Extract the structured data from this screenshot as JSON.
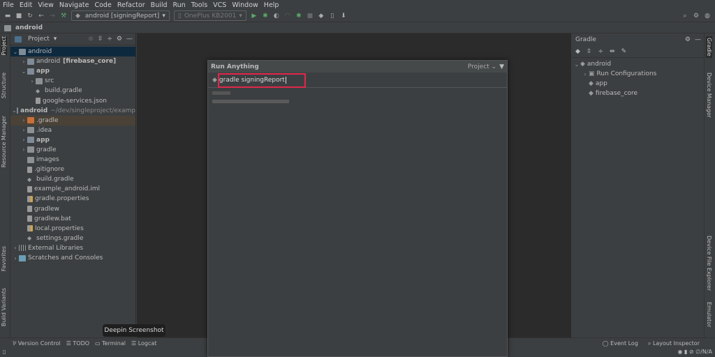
{
  "menu": [
    "File",
    "Edit",
    "View",
    "Navigate",
    "Code",
    "Refactor",
    "Build",
    "Run",
    "Tools",
    "VCS",
    "Window",
    "Help"
  ],
  "toolbar": {
    "run_config": "android [signingReport]",
    "device": "OnePlus KB2001"
  },
  "breadcrumb": "android",
  "left_stripe": [
    "Project",
    "Structure",
    "Resource Manager",
    "Favorites",
    "Build Variants"
  ],
  "project_panel": {
    "title": "Project",
    "tree": [
      {
        "label": "android",
        "depth": 0,
        "arrow": "v",
        "bold": false,
        "selected": true,
        "icon": "module"
      },
      {
        "label": "android",
        "suffix": "[firebase_core]",
        "depth": 1,
        "arrow": ">",
        "icon": "module"
      },
      {
        "label": "app",
        "depth": 1,
        "arrow": "v",
        "bold": true,
        "icon": "module"
      },
      {
        "label": "src",
        "depth": 2,
        "arrow": ">",
        "icon": "folder"
      },
      {
        "label": "build.gradle",
        "depth": 2,
        "arrow": "",
        "icon": "gradle"
      },
      {
        "label": "google-services.json",
        "depth": 2,
        "arrow": "",
        "icon": "file"
      },
      {
        "label": "android",
        "suffix": "~/dev/singleproject/examp",
        "depth": 0,
        "arrow": "v",
        "bold": true,
        "icon": "module"
      },
      {
        "label": ".gradle",
        "depth": 1,
        "arrow": ">",
        "icon": "folder-orange",
        "highlight": true
      },
      {
        "label": ".idea",
        "depth": 1,
        "arrow": ">",
        "icon": "folder"
      },
      {
        "label": "app",
        "depth": 1,
        "arrow": ">",
        "bold": true,
        "icon": "module"
      },
      {
        "label": "gradle",
        "depth": 1,
        "arrow": ">",
        "icon": "folder"
      },
      {
        "label": "images",
        "depth": 1,
        "arrow": "",
        "icon": "folder"
      },
      {
        "label": ".gitignore",
        "depth": 1,
        "arrow": "",
        "icon": "file"
      },
      {
        "label": "build.gradle",
        "depth": 1,
        "arrow": "",
        "icon": "gradle"
      },
      {
        "label": "example_android.iml",
        "depth": 1,
        "arrow": "",
        "icon": "file"
      },
      {
        "label": "gradle.properties",
        "depth": 1,
        "arrow": "",
        "icon": "properties"
      },
      {
        "label": "gradlew",
        "depth": 1,
        "arrow": "",
        "icon": "file"
      },
      {
        "label": "gradlew.bat",
        "depth": 1,
        "arrow": "",
        "icon": "file"
      },
      {
        "label": "local.properties",
        "depth": 1,
        "arrow": "",
        "icon": "properties"
      },
      {
        "label": "settings.gradle",
        "depth": 1,
        "arrow": "",
        "icon": "gradle"
      },
      {
        "label": "External Libraries",
        "depth": 0,
        "arrow": ">",
        "icon": "library"
      },
      {
        "label": "Scratches and Consoles",
        "depth": 0,
        "arrow": ">",
        "icon": "scratch"
      }
    ]
  },
  "run_anything": {
    "title": "Run Anything",
    "scope": "Project",
    "input": "gradle signingReport"
  },
  "gradle_panel": {
    "title": "Gradle",
    "tree": [
      {
        "label": "android",
        "depth": 0,
        "arrow": "v"
      },
      {
        "label": "Run Configurations",
        "depth": 1,
        "arrow": ">"
      },
      {
        "label": "app",
        "depth": 1,
        "arrow": ""
      },
      {
        "label": "firebase_core",
        "depth": 1,
        "arrow": ""
      }
    ]
  },
  "right_stripe": [
    "Gradle",
    "Device Manager",
    "Device File Explorer",
    "Emulator"
  ],
  "bottom_tools": {
    "left": [
      "Version Control",
      "TODO",
      "Terminal",
      "Logcat"
    ],
    "right": [
      "Event Log",
      "Layout Inspector"
    ]
  },
  "tooltip": "Deepin Screenshot",
  "status": {
    "right": "∅/N/A"
  },
  "colors": {
    "highlight_box": "#e0284a",
    "selection": "#0d293e",
    "run_green": "#59a869"
  }
}
